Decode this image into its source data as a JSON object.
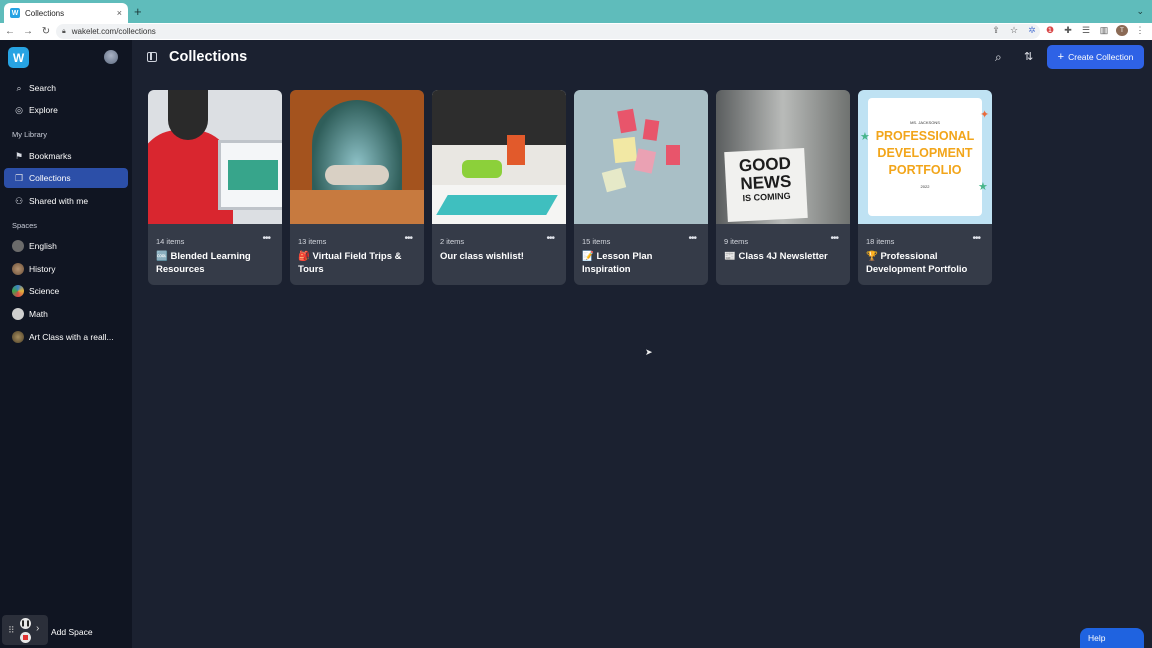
{
  "browser": {
    "tab_title": "Collections",
    "tab_favicon": "W",
    "tab_close": "×",
    "new_tab": "+",
    "tab_menu": "⌄",
    "url": "wakelet.com/collections"
  },
  "sidebar": {
    "logo": "W",
    "nav": [
      {
        "label": "Search",
        "icon": "search-icon"
      },
      {
        "label": "Explore",
        "icon": "compass-icon"
      }
    ],
    "library_label": "My Library",
    "library": [
      {
        "label": "Bookmarks",
        "icon": "bookmark-icon"
      },
      {
        "label": "Collections",
        "icon": "collections-icon",
        "active": true
      },
      {
        "label": "Shared with me",
        "icon": "people-icon"
      }
    ],
    "spaces_label": "Spaces",
    "spaces": [
      {
        "label": "English",
        "color": "#6b6b6b"
      },
      {
        "label": "History",
        "color": "#8a6b52"
      },
      {
        "label": "Science",
        "color": "#3b82c4"
      },
      {
        "label": "Math",
        "color": "#c9c9c9"
      },
      {
        "label": "Art Class with a reall...",
        "color": "#7a6a4a"
      }
    ],
    "add_space": "Add Space"
  },
  "header": {
    "title": "Collections",
    "create_label": "Create Collection"
  },
  "collections": [
    {
      "count": "14 items",
      "title": "🆒 Blended Learning Resources",
      "theme": "blended"
    },
    {
      "count": "13 items",
      "title": "🎒 Virtual Field Trips & Tours",
      "theme": "tent"
    },
    {
      "count": "2 items",
      "title": "Our class wishlist!",
      "theme": "classroom"
    },
    {
      "count": "15 items",
      "title": "📝 Lesson Plan Inspiration",
      "theme": "sticky"
    },
    {
      "count": "9 items",
      "title": "📰 Class 4J Newsletter",
      "theme": "goodnews"
    },
    {
      "count": "18 items",
      "title": "🏆 Professional Development Portfolio",
      "theme": "portfolio"
    }
  ],
  "thumb_text": {
    "goodnews": [
      "GOOD",
      "NEWS",
      "IS COMING"
    ],
    "portfolio_small": "MS. JACKSONS",
    "portfolio_lines": [
      "PROFESSIONAL",
      "DEVELOPMENT",
      "PORTFOLIO"
    ],
    "portfolio_year": "2022"
  },
  "help_label": "Help",
  "colors": {
    "accent": "#2e62e6",
    "sidebar_active": "#2c4fa8",
    "background": "#1b2130",
    "card": "#353b48"
  }
}
